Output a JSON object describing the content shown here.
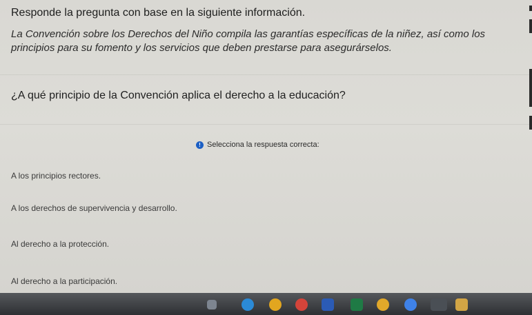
{
  "prompt": "Responde la pregunta con base en la siguiente información.",
  "context": "La Convención sobre los Derechos del Niño compila las garantías específicas de la niñez, así como los principios para su fomento y los servicios que deben prestarse para asegurárselos.",
  "question": "¿A qué principio de la Convención aplica el derecho a la educación?",
  "instruction": "Selecciona la respuesta correcta:",
  "options": [
    "A los principios rectores.",
    "A los derechos de supervivencia y desarrollo.",
    "Al derecho a la protección.",
    "Al derecho a la participación."
  ],
  "colors": {
    "accent": "#1c5fc4",
    "taskbar": "#3a3c40"
  },
  "taskbar_icons": [
    "file-explorer-icon",
    "edge-browser-icon",
    "chrome-icon",
    "settings-icon",
    "word-icon",
    "excel-icon",
    "chrome-alt-icon",
    "google-translate-icon",
    "photos-icon",
    "folder-icon"
  ]
}
